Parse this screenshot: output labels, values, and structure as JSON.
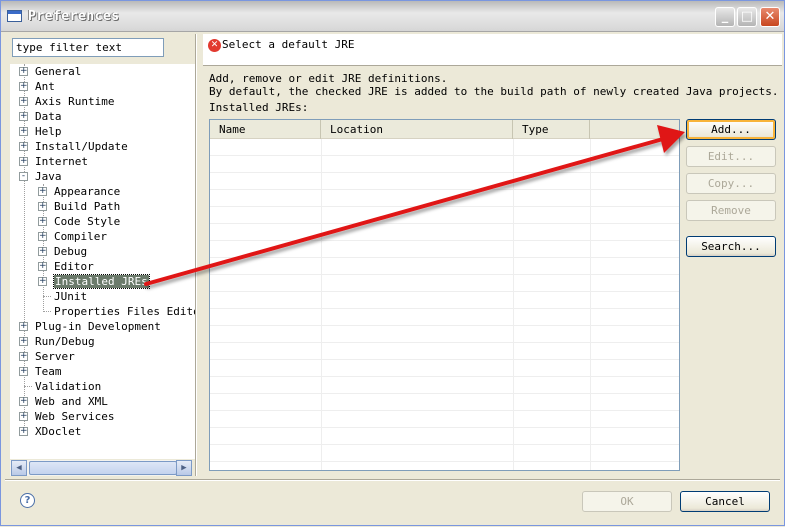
{
  "window": {
    "title": "Preferences",
    "controls": [
      "_",
      "□",
      "✕"
    ]
  },
  "filter": {
    "value": "type filter text"
  },
  "tree": {
    "items": [
      {
        "label": "General",
        "expander": "+"
      },
      {
        "label": "Ant",
        "expander": "+"
      },
      {
        "label": "Axis Runtime",
        "expander": "+"
      },
      {
        "label": "Data",
        "expander": "+"
      },
      {
        "label": "Help",
        "expander": "+"
      },
      {
        "label": "Install/Update",
        "expander": "+"
      },
      {
        "label": "Internet",
        "expander": "+"
      },
      {
        "label": "Java",
        "expander": "-"
      },
      {
        "label": "Appearance",
        "expander": "+"
      },
      {
        "label": "Build Path",
        "expander": "+"
      },
      {
        "label": "Code Style",
        "expander": "+"
      },
      {
        "label": "Compiler",
        "expander": "+"
      },
      {
        "label": "Debug",
        "expander": "+"
      },
      {
        "label": "Editor",
        "expander": "+"
      },
      {
        "label": "Installed JREs",
        "expander": "+"
      },
      {
        "label": "JUnit",
        "expander": ""
      },
      {
        "label": "Properties Files Editor",
        "expander": ""
      },
      {
        "label": "Plug-in Development",
        "expander": "+"
      },
      {
        "label": "Run/Debug",
        "expander": "+"
      },
      {
        "label": "Server",
        "expander": "+"
      },
      {
        "label": "Team",
        "expander": "+"
      },
      {
        "label": "Validation",
        "expander": ""
      },
      {
        "label": "Web and XML",
        "expander": "+"
      },
      {
        "label": "Web Services",
        "expander": "+"
      },
      {
        "label": "XDoclet",
        "expander": "+"
      }
    ]
  },
  "message": {
    "icon": "error-icon",
    "text": "Select a default JRE"
  },
  "page": {
    "desc_line1": "Add, remove or edit JRE definitions.",
    "desc_line2": "By default, the checked JRE is added to the build path of newly created Java projects.",
    "installed_label": "Installed JREs:"
  },
  "table": {
    "columns": [
      "Name",
      "Location",
      "Type",
      ""
    ]
  },
  "buttons": {
    "add": "Add...",
    "edit": "Edit...",
    "copy": "Copy...",
    "remove": "Remove",
    "search": "Search...",
    "ok": "OK",
    "cancel": "Cancel"
  },
  "colors": {
    "annotation_arrow": "#e01818",
    "selection": "#6b7a6b"
  }
}
